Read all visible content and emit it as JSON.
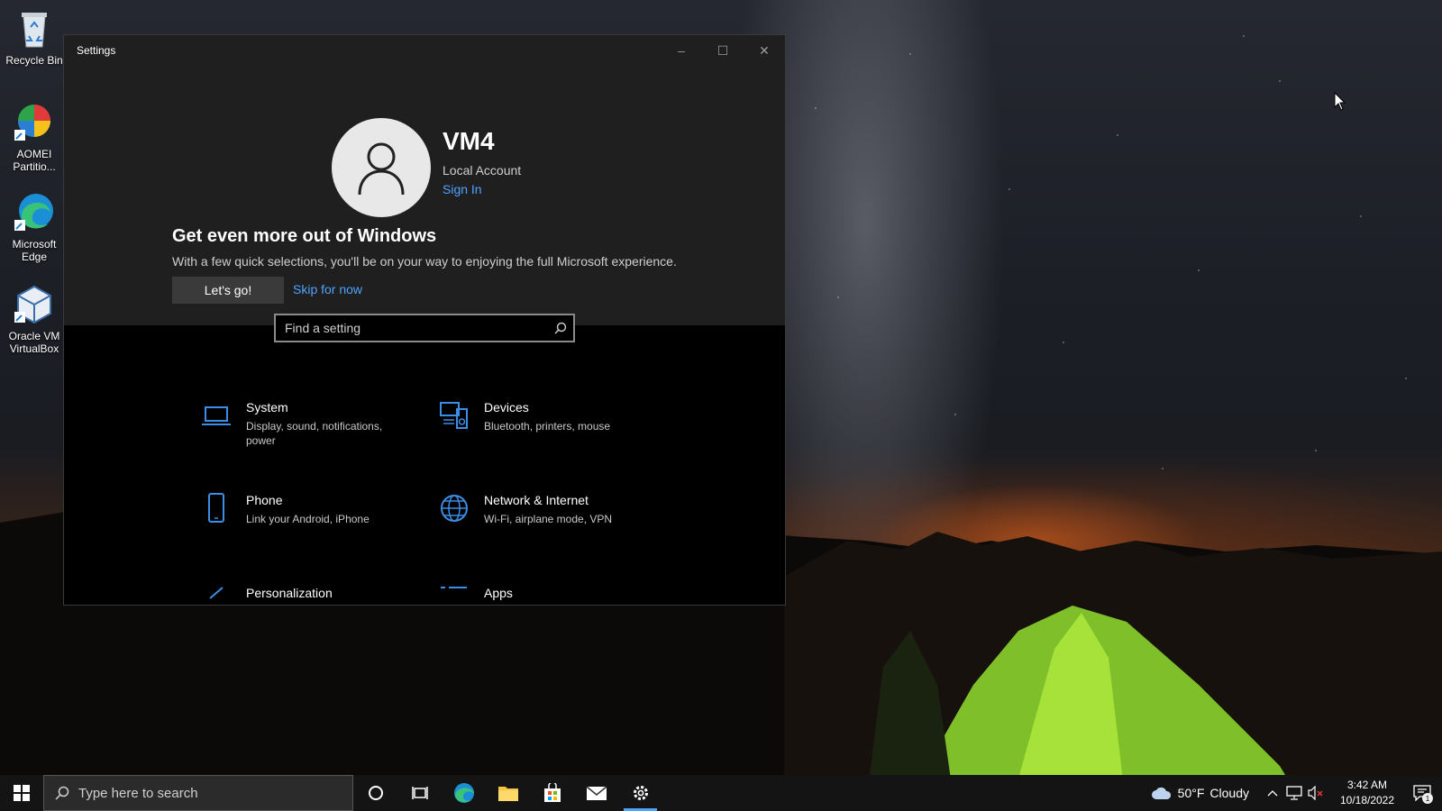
{
  "desktop": {
    "icons": [
      {
        "label": "Recycle Bin",
        "icon": "recycle-bin-icon"
      },
      {
        "label": "AOMEI Partitio...",
        "icon": "aomei-partition-icon"
      },
      {
        "label": "Microsoft Edge",
        "icon": "edge-icon"
      },
      {
        "label": "Oracle VM VirtualBox",
        "icon": "virtualbox-icon"
      }
    ]
  },
  "window": {
    "title": "Settings",
    "controls": {
      "minimize": "–",
      "maximize": "☐",
      "close": "✕"
    }
  },
  "account": {
    "name": "VM4",
    "type": "Local Account",
    "sign_in": "Sign In"
  },
  "promo": {
    "title": "Get even more out of Windows",
    "description": "With a few quick selections, you'll be on your way to enjoying the full Microsoft experience.",
    "primary_button": "Let's go!",
    "secondary_link": "Skip for now"
  },
  "search": {
    "placeholder": "Find a setting"
  },
  "categories": [
    {
      "name": "System",
      "description": "Display, sound, notifications, power",
      "icon": "laptop-icon"
    },
    {
      "name": "Devices",
      "description": "Bluetooth, printers, mouse",
      "icon": "devices-icon"
    },
    {
      "name": "Phone",
      "description": "Link your Android, iPhone",
      "icon": "phone-icon"
    },
    {
      "name": "Network & Internet",
      "description": "Wi-Fi, airplane mode, VPN",
      "icon": "globe-icon"
    },
    {
      "name": "Personalization",
      "description": "",
      "icon": "brush-icon"
    },
    {
      "name": "Apps",
      "description": "",
      "icon": "apps-list-icon"
    }
  ],
  "taskbar": {
    "search_placeholder": "Type here to search",
    "weather_temp": "50°F",
    "weather_desc": "Cloudy",
    "time": "3:42 AM",
    "date": "10/18/2022",
    "notification_count": "1"
  },
  "colors": {
    "accent": "#4ea3ff",
    "window_bg": "#000000",
    "panel_bg": "#1f1f1f"
  }
}
